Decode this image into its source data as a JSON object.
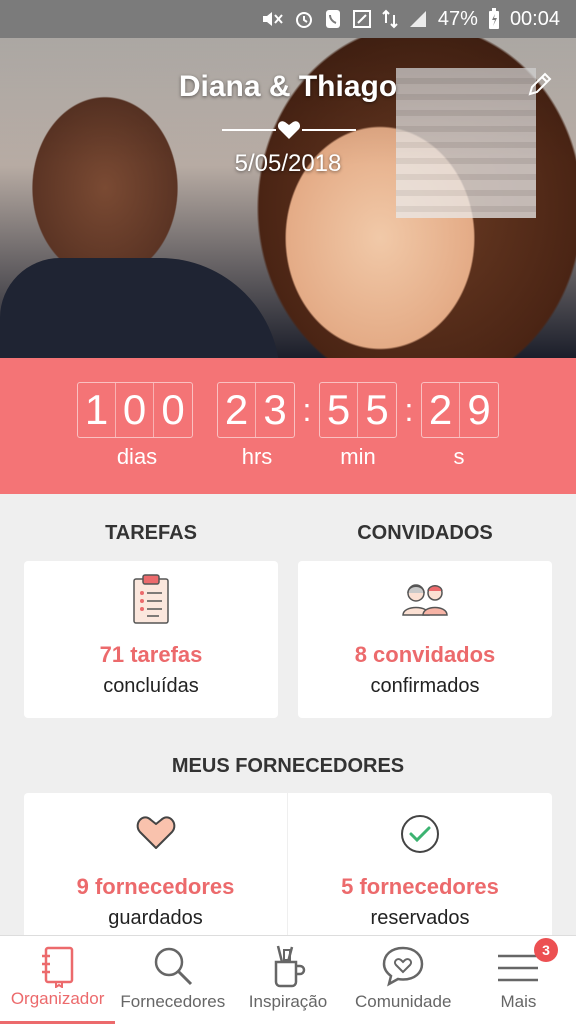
{
  "status_bar": {
    "battery": "47%",
    "time": "00:04",
    "icons": [
      "mute-icon",
      "alarm-icon",
      "phone-icon",
      "screenshot-icon",
      "data-icon",
      "signal-icon",
      "battery-charging-icon"
    ]
  },
  "hero": {
    "couple_names": "Diana & Thiago",
    "wedding_date": "5/05/2018",
    "edit_icon": "pencil-icon"
  },
  "countdown": {
    "days": [
      "1",
      "0",
      "0"
    ],
    "hours": [
      "2",
      "3"
    ],
    "minutes": [
      "5",
      "5"
    ],
    "seconds": [
      "2",
      "9"
    ],
    "separator": ":",
    "labels": {
      "days": "dias",
      "hours": "hrs",
      "minutes": "min",
      "seconds": "s"
    }
  },
  "tasks": {
    "title": "TAREFAS",
    "value": "71 tarefas",
    "caption": "concluídas",
    "icon": "clipboard-icon"
  },
  "guests": {
    "title": "CONVIDADOS",
    "value": "8 convidados",
    "caption": "confirmados",
    "icon": "guests-icon"
  },
  "vendors": {
    "title": "MEUS FORNECEDORES",
    "saved": {
      "value": "9 fornecedores",
      "caption": "guardados",
      "icon": "heart-icon"
    },
    "booked": {
      "value": "5 fornecedores",
      "caption": "reservados",
      "icon": "check-circle-icon"
    }
  },
  "bottom_nav": {
    "items": [
      {
        "label": "Organizador",
        "icon": "notebook-icon",
        "active": true
      },
      {
        "label": "Fornecedores",
        "icon": "search-icon"
      },
      {
        "label": "Inspiração",
        "icon": "brush-cup-icon"
      },
      {
        "label": "Comunidade",
        "icon": "chat-heart-icon"
      },
      {
        "label": "Mais",
        "icon": "menu-icon",
        "badge": "3"
      }
    ]
  },
  "colors": {
    "accent": "#f47476",
    "accent_text": "#ec6a6c",
    "badge": "#ec5052"
  }
}
